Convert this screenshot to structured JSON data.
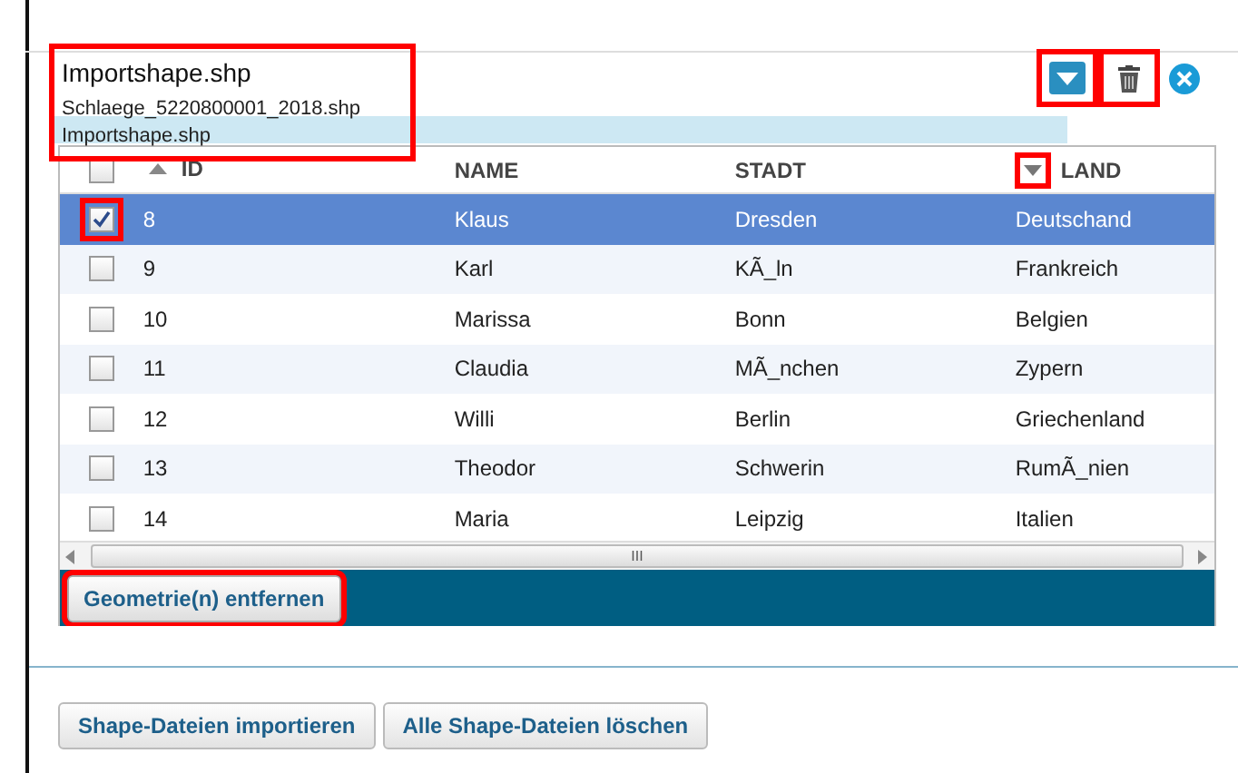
{
  "file_select": {
    "value": "Importshape.shp",
    "options": [
      {
        "label": "Schlaege_5220800001_2018.shp",
        "selected": false
      },
      {
        "label": "Importshape.shp",
        "selected": true
      }
    ],
    "highlighted": true
  },
  "toolbar": [
    {
      "kind": "download",
      "highlighted": true
    },
    {
      "kind": "delete",
      "highlighted": true
    },
    {
      "kind": "close",
      "highlighted": false
    }
  ],
  "table": {
    "all_checked": false,
    "columns": [
      {
        "label": "ID",
        "sort_marker": {
          "kind": "up",
          "highlighted": false
        }
      },
      {
        "label": "NAME"
      },
      {
        "label": "STADT"
      },
      {
        "label": "LAND",
        "sort_marker": {
          "kind": "down",
          "highlighted": true
        }
      }
    ],
    "rows": [
      {
        "cells": [
          "8",
          "Klaus",
          "Dresden",
          "Deutschand"
        ],
        "checked": true,
        "selected": true,
        "highlighted": true
      },
      {
        "cells": [
          "9",
          "Karl",
          "KÃ_ln",
          "Frankreich"
        ],
        "checked": false,
        "selected": false,
        "highlighted": false
      },
      {
        "cells": [
          "10",
          "Marissa",
          "Bonn",
          "Belgien"
        ],
        "checked": false,
        "selected": false,
        "highlighted": false
      },
      {
        "cells": [
          "11",
          "Claudia",
          "MÃ_nchen",
          "Zypern"
        ],
        "checked": false,
        "selected": false,
        "highlighted": false
      },
      {
        "cells": [
          "12",
          "Willi",
          "Berlin",
          "Griechenland"
        ],
        "checked": false,
        "selected": false,
        "highlighted": false
      },
      {
        "cells": [
          "13",
          "Theodor",
          "Schwerin",
          "RumÃ_nien"
        ],
        "checked": false,
        "selected": false,
        "highlighted": false
      },
      {
        "cells": [
          "14",
          "Maria",
          "Leipzig",
          "Italien"
        ],
        "checked": false,
        "selected": false,
        "highlighted": false
      }
    ],
    "scroll_thumb": "III"
  },
  "remove_button": {
    "label": "Geometrie(n) entfernen",
    "highlighted": true
  },
  "footer_buttons": [
    "Shape-Dateien importieren",
    "Alle Shape-Dateien löschen"
  ]
}
